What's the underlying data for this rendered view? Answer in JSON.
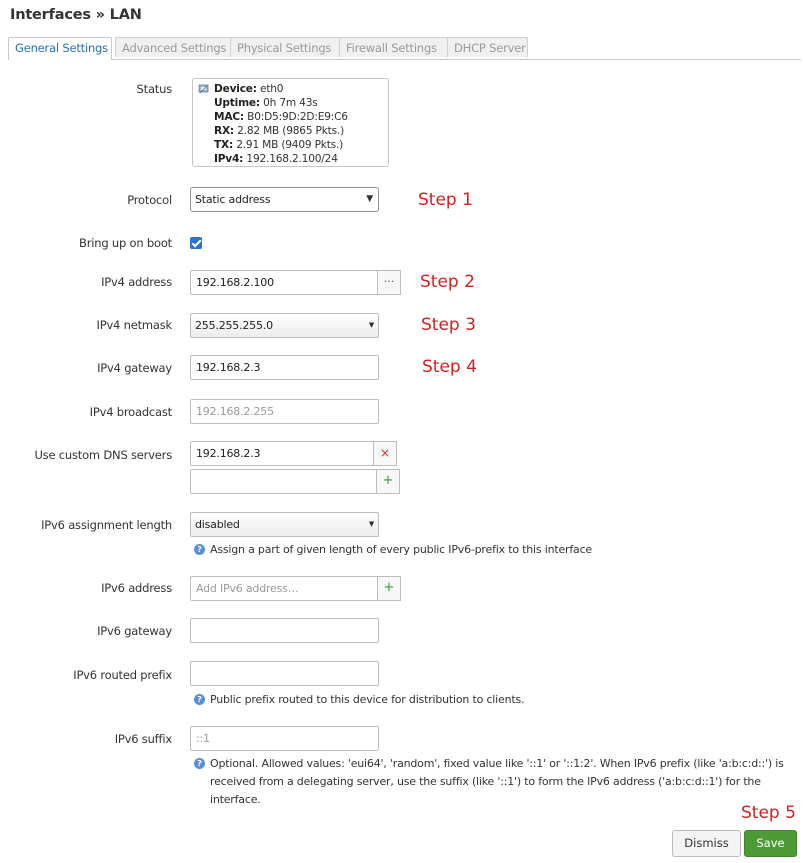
{
  "page": {
    "title": "Interfaces » LAN"
  },
  "tabs": [
    {
      "label": "General Settings",
      "active": true
    },
    {
      "label": "Advanced Settings"
    },
    {
      "label": "Physical Settings"
    },
    {
      "label": "Firewall Settings"
    },
    {
      "label": "DHCP Server"
    }
  ],
  "status": {
    "label": "Status",
    "lines": [
      {
        "key": "Device:",
        "value": " eth0"
      },
      {
        "key": "Uptime:",
        "value": " 0h 7m 43s"
      },
      {
        "key": "MAC:",
        "value": " B0:D5:9D:2D:E9:C6"
      },
      {
        "key": "RX:",
        "value": " 2.82 MB (9865 Pkts.)"
      },
      {
        "key": "TX:",
        "value": " 2.91 MB (9409 Pkts.)"
      },
      {
        "key": "IPv4:",
        "value": " 192.168.2.100/24"
      }
    ]
  },
  "protocol": {
    "label": "Protocol",
    "value": "Static address"
  },
  "boot": {
    "label": "Bring up on boot",
    "checked": true
  },
  "ipv4_address": {
    "label": "IPv4 address",
    "value": "192.168.2.100",
    "more": "···"
  },
  "ipv4_netmask": {
    "label": "IPv4 netmask",
    "value": "255.255.255.0"
  },
  "ipv4_gateway": {
    "label": "IPv4 gateway",
    "value": "192.168.2.3"
  },
  "ipv4_broadcast": {
    "label": "IPv4 broadcast",
    "placeholder": "192.168.2.255"
  },
  "dns": {
    "label": "Use custom DNS servers",
    "value": "192.168.2.3",
    "remove": "×",
    "add": "+"
  },
  "ipv6_assign": {
    "label": "IPv6 assignment length",
    "value": "disabled",
    "help": "Assign a part of given length of every public IPv6-prefix to this interface"
  },
  "ipv6_address": {
    "label": "IPv6 address",
    "placeholder": "Add IPv6 address…",
    "add": "+"
  },
  "ipv6_gateway": {
    "label": "IPv6 gateway"
  },
  "ipv6_prefix": {
    "label": "IPv6 routed prefix",
    "help": "Public prefix routed to this device for distribution to clients."
  },
  "ipv6_suffix": {
    "label": "IPv6 suffix",
    "placeholder": "::1",
    "help": "Optional. Allowed values: 'eui64', 'random', fixed value like '::1' or '::1:2'. When IPv6 prefix (like 'a:b:c:d::') is received from a delegating server, use the suffix (like '::1') to form the IPv6 address ('a:b:c:d::1') for the interface."
  },
  "help_icon": "?",
  "steps": {
    "s1": "Step 1",
    "s2": "Step 2",
    "s3": "Step 3",
    "s4": "Step 4",
    "s5": "Step 5"
  },
  "buttons": {
    "dismiss": "Dismiss",
    "save": "Save"
  },
  "colors": {
    "accent": "#2a70b8",
    "save": "#4e9a34",
    "step": "#d52020"
  }
}
